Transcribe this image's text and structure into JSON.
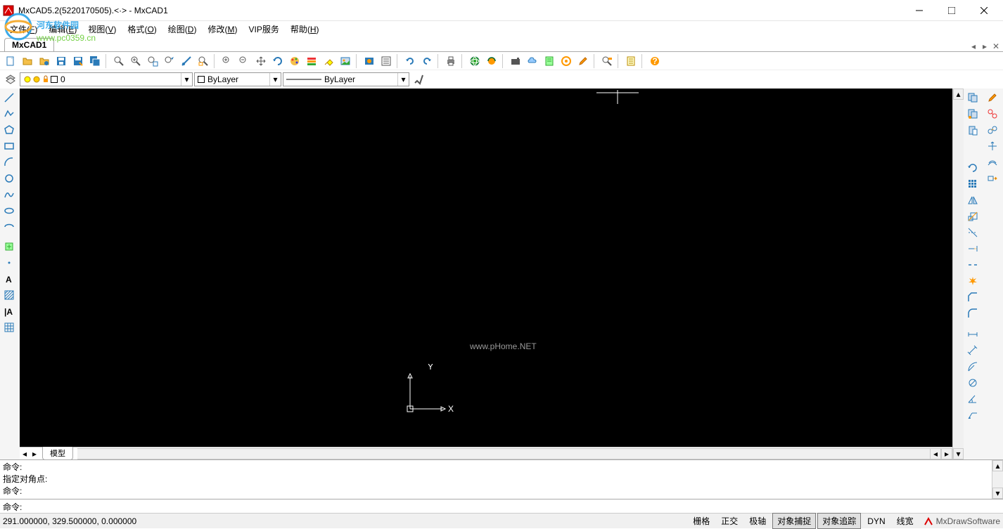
{
  "window": {
    "title": "MxCAD5.2(5220170505).<·> - MxCAD1"
  },
  "menu": {
    "file": "文件",
    "file_key": "F",
    "edit": "编辑",
    "edit_key": "E",
    "view": "视图",
    "view_key": "V",
    "format": "格式",
    "format_key": "O",
    "draw": "绘图",
    "draw_key": "D",
    "modify": "修改",
    "modify_key": "M",
    "vip": "VIP服务",
    "help": "帮助",
    "help_key": "H"
  },
  "doc_tab": "MxCAD1",
  "layer_selector": {
    "value": "0"
  },
  "color_selector": {
    "value": "ByLayer"
  },
  "linetype_selector": {
    "value": "ByLayer"
  },
  "model_tab": "模型",
  "ucs": {
    "x": "X",
    "y": "Y"
  },
  "watermark": "www.pHome.NET",
  "logo_watermark": {
    "line1": "河东软件园",
    "line2": "www.pc0359.cn"
  },
  "cmd": {
    "line1": "命令:",
    "line2": "指定对角点:",
    "line3": "命令:",
    "prompt": "命令:"
  },
  "status": {
    "coords": "291.000000,  329.500000,  0.000000",
    "grid": "栅格",
    "ortho": "正交",
    "polar": "极轴",
    "osnap": "对象捕捉",
    "otrack": "对象追踪",
    "dyn": "DYN",
    "lwt": "线宽",
    "brand": "MxDrawSoftware"
  }
}
